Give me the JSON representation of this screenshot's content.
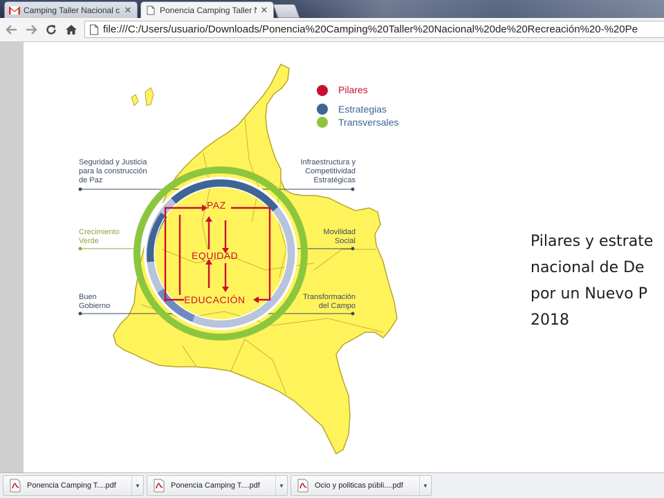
{
  "tabs": [
    {
      "title": "Camping Taller Nacional c",
      "favicon": "gmail-icon",
      "active": false
    },
    {
      "title": "Ponencia Camping Taller N",
      "favicon": "document-icon",
      "active": true
    }
  ],
  "toolbar": {
    "url": "file:///C:/Users/usuario/Downloads/Ponencia%20Camping%20Taller%20Nacional%20de%20Recreación%20-%20Pe"
  },
  "slide": {
    "legend": [
      {
        "label": "Pilares",
        "color": "#c8102e"
      },
      {
        "label": "Estrategias",
        "color": "#3e6596"
      },
      {
        "label": "Transversales",
        "color": "#8cc63f"
      }
    ],
    "callouts": {
      "seguridad": [
        "Seguridad y Justicia",
        "para la construcción",
        "de Paz"
      ],
      "crecimiento": [
        "Crecimiento",
        "Verde"
      ],
      "buen_gobierno": [
        "Buen",
        "Gobierno"
      ],
      "infraestructura": [
        "Infraestructura y",
        "Competitividad",
        "Estratégicas"
      ],
      "movilidad": [
        "Movilidad",
        "Social"
      ],
      "transformacion": [
        "Transformación",
        "del Campo"
      ]
    },
    "pillars": {
      "paz": "PAZ",
      "equidad": "EQUIDAD",
      "educacion": "EDUCACIÓN"
    },
    "heading": [
      "Pilares y estrate",
      "nacional de De",
      "por un Nuevo P",
      "2018"
    ]
  },
  "downloads": [
    {
      "name": "Ponencia Camping T....pdf"
    },
    {
      "name": "Ponencia Camping T....pdf"
    },
    {
      "name": "Ocio y politicas públi....pdf"
    }
  ]
}
